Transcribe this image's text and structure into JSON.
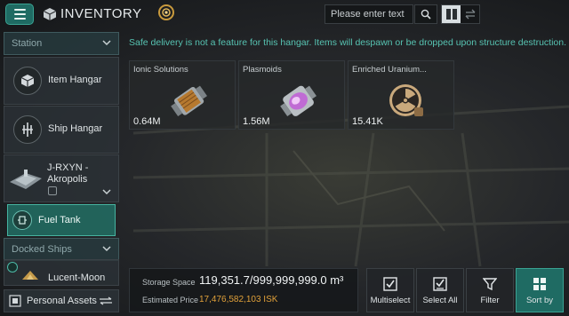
{
  "header": {
    "title": "INVENTORY",
    "search_placeholder": "Please enter text"
  },
  "sidebar": {
    "station_header": "Station",
    "items": [
      {
        "label": "Item Hangar",
        "icon": "item-hangar-icon"
      },
      {
        "label": "Ship Hangar",
        "icon": "ship-hangar-icon"
      }
    ],
    "structure": {
      "line1": "J-RXYN -",
      "line2": "Akropolis"
    },
    "fuel_tank": {
      "label": "Fuel Tank"
    },
    "docked_header": "Docked Ships",
    "docked_ship": {
      "label": "Lucent-Moon"
    },
    "personal_assets": "Personal Assets"
  },
  "notice": "Safe delivery is not a feature for this hangar. Items will despawn or be dropped upon structure destruction.",
  "items": [
    {
      "name": "Ionic Solutions",
      "quantity": "0.64M",
      "icon": "ionic-solutions-canister-icon"
    },
    {
      "name": "Plasmoids",
      "quantity": "1.56M",
      "icon": "plasmoids-canister-icon"
    },
    {
      "name": "Enriched Uranium...",
      "quantity": "15.41K",
      "icon": "radiation-icon"
    }
  ],
  "storage": {
    "space_label": "Storage Space",
    "space_value": "119,351.7/999,999,999.0 m³",
    "price_label": "Estimated Price",
    "price_value": "17,476,582,103 ISK"
  },
  "actions": {
    "multiselect": "Multiselect",
    "select_all": "Select All",
    "filter": "Filter",
    "sort_by": "Sort by"
  },
  "colors": {
    "accent": "#1f6b63",
    "notice": "#57c3b2",
    "price": "#e0a03a"
  }
}
